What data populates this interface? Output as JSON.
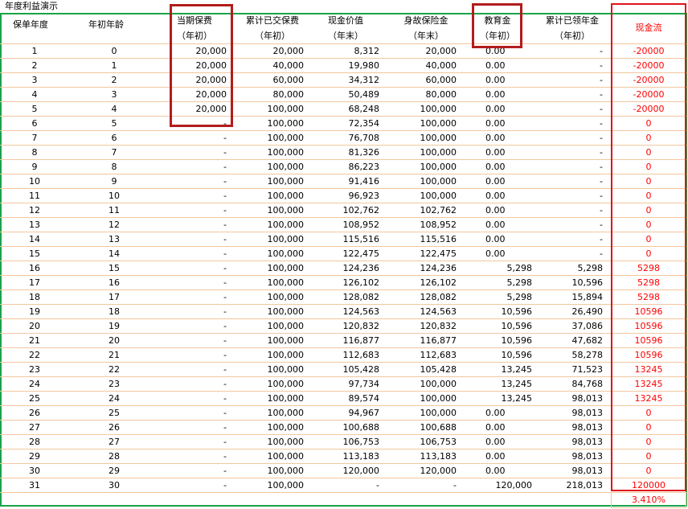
{
  "title": "年度利益演示",
  "headers": {
    "policy_year": "保单年度",
    "age": "年初年龄",
    "premium": [
      "当期保费",
      "（年初）"
    ],
    "total_premium": [
      "累计已交保费",
      "（年初）"
    ],
    "cash_value": [
      "现金价值",
      "（年末）"
    ],
    "death_benefit": [
      "身故保险金",
      "（年末）"
    ],
    "education": [
      "教育金",
      "（年初）"
    ],
    "total_annuity": [
      "累计已领年金",
      "（年初）"
    ],
    "cash_flow": "现金流"
  },
  "rows": [
    [
      "1",
      "0",
      "20,000",
      "20,000",
      "8,312",
      "20,000",
      "0.00",
      "-",
      "-20000"
    ],
    [
      "2",
      "1",
      "20,000",
      "40,000",
      "19,980",
      "40,000",
      "0.00",
      "-",
      "-20000"
    ],
    [
      "3",
      "2",
      "20,000",
      "60,000",
      "34,312",
      "60,000",
      "0.00",
      "-",
      "-20000"
    ],
    [
      "4",
      "3",
      "20,000",
      "80,000",
      "50,489",
      "80,000",
      "0.00",
      "-",
      "-20000"
    ],
    [
      "5",
      "4",
      "20,000",
      "100,000",
      "68,248",
      "100,000",
      "0.00",
      "-",
      "-20000"
    ],
    [
      "6",
      "5",
      "-",
      "100,000",
      "72,354",
      "100,000",
      "0.00",
      "-",
      "0"
    ],
    [
      "7",
      "6",
      "-",
      "100,000",
      "76,708",
      "100,000",
      "0.00",
      "-",
      "0"
    ],
    [
      "8",
      "7",
      "-",
      "100,000",
      "81,326",
      "100,000",
      "0.00",
      "-",
      "0"
    ],
    [
      "9",
      "8",
      "-",
      "100,000",
      "86,223",
      "100,000",
      "0.00",
      "-",
      "0"
    ],
    [
      "10",
      "9",
      "-",
      "100,000",
      "91,416",
      "100,000",
      "0.00",
      "-",
      "0"
    ],
    [
      "11",
      "10",
      "-",
      "100,000",
      "96,923",
      "100,000",
      "0.00",
      "-",
      "0"
    ],
    [
      "12",
      "11",
      "-",
      "100,000",
      "102,762",
      "102,762",
      "0.00",
      "-",
      "0"
    ],
    [
      "13",
      "12",
      "-",
      "100,000",
      "108,952",
      "108,952",
      "0.00",
      "-",
      "0"
    ],
    [
      "14",
      "13",
      "-",
      "100,000",
      "115,516",
      "115,516",
      "0.00",
      "-",
      "0"
    ],
    [
      "15",
      "14",
      "-",
      "100,000",
      "122,475",
      "122,475",
      "0.00",
      "-",
      "0"
    ],
    [
      "16",
      "15",
      "-",
      "100,000",
      "124,236",
      "124,236",
      "5,298",
      "5,298",
      "5298"
    ],
    [
      "17",
      "16",
      "-",
      "100,000",
      "126,102",
      "126,102",
      "5,298",
      "10,596",
      "5298"
    ],
    [
      "18",
      "17",
      "-",
      "100,000",
      "128,082",
      "128,082",
      "5,298",
      "15,894",
      "5298"
    ],
    [
      "19",
      "18",
      "-",
      "100,000",
      "124,563",
      "124,563",
      "10,596",
      "26,490",
      "10596"
    ],
    [
      "20",
      "19",
      "-",
      "100,000",
      "120,832",
      "120,832",
      "10,596",
      "37,086",
      "10596"
    ],
    [
      "21",
      "20",
      "-",
      "100,000",
      "116,877",
      "116,877",
      "10,596",
      "47,682",
      "10596"
    ],
    [
      "22",
      "21",
      "-",
      "100,000",
      "112,683",
      "112,683",
      "10,596",
      "58,278",
      "10596"
    ],
    [
      "23",
      "22",
      "-",
      "100,000",
      "105,428",
      "105,428",
      "13,245",
      "71,523",
      "13245"
    ],
    [
      "24",
      "23",
      "-",
      "100,000",
      "97,734",
      "100,000",
      "13,245",
      "84,768",
      "13245"
    ],
    [
      "25",
      "24",
      "-",
      "100,000",
      "89,574",
      "100,000",
      "13,245",
      "98,013",
      "13245"
    ],
    [
      "26",
      "25",
      "-",
      "100,000",
      "94,967",
      "100,000",
      "0.00",
      "98,013",
      "0"
    ],
    [
      "27",
      "26",
      "-",
      "100,000",
      "100,688",
      "100,688",
      "0.00",
      "98,013",
      "0"
    ],
    [
      "28",
      "27",
      "-",
      "100,000",
      "106,753",
      "106,753",
      "0.00",
      "98,013",
      "0"
    ],
    [
      "29",
      "28",
      "-",
      "100,000",
      "113,183",
      "113,183",
      "0.00",
      "98,013",
      "0"
    ],
    [
      "30",
      "29",
      "-",
      "100,000",
      "120,000",
      "120,000",
      "0.00",
      "98,013",
      "0"
    ],
    [
      "31",
      "30",
      "-",
      "100,000",
      "-",
      "-",
      "120,000",
      "218,013",
      "120000"
    ]
  ],
  "irr": "3.410%"
}
